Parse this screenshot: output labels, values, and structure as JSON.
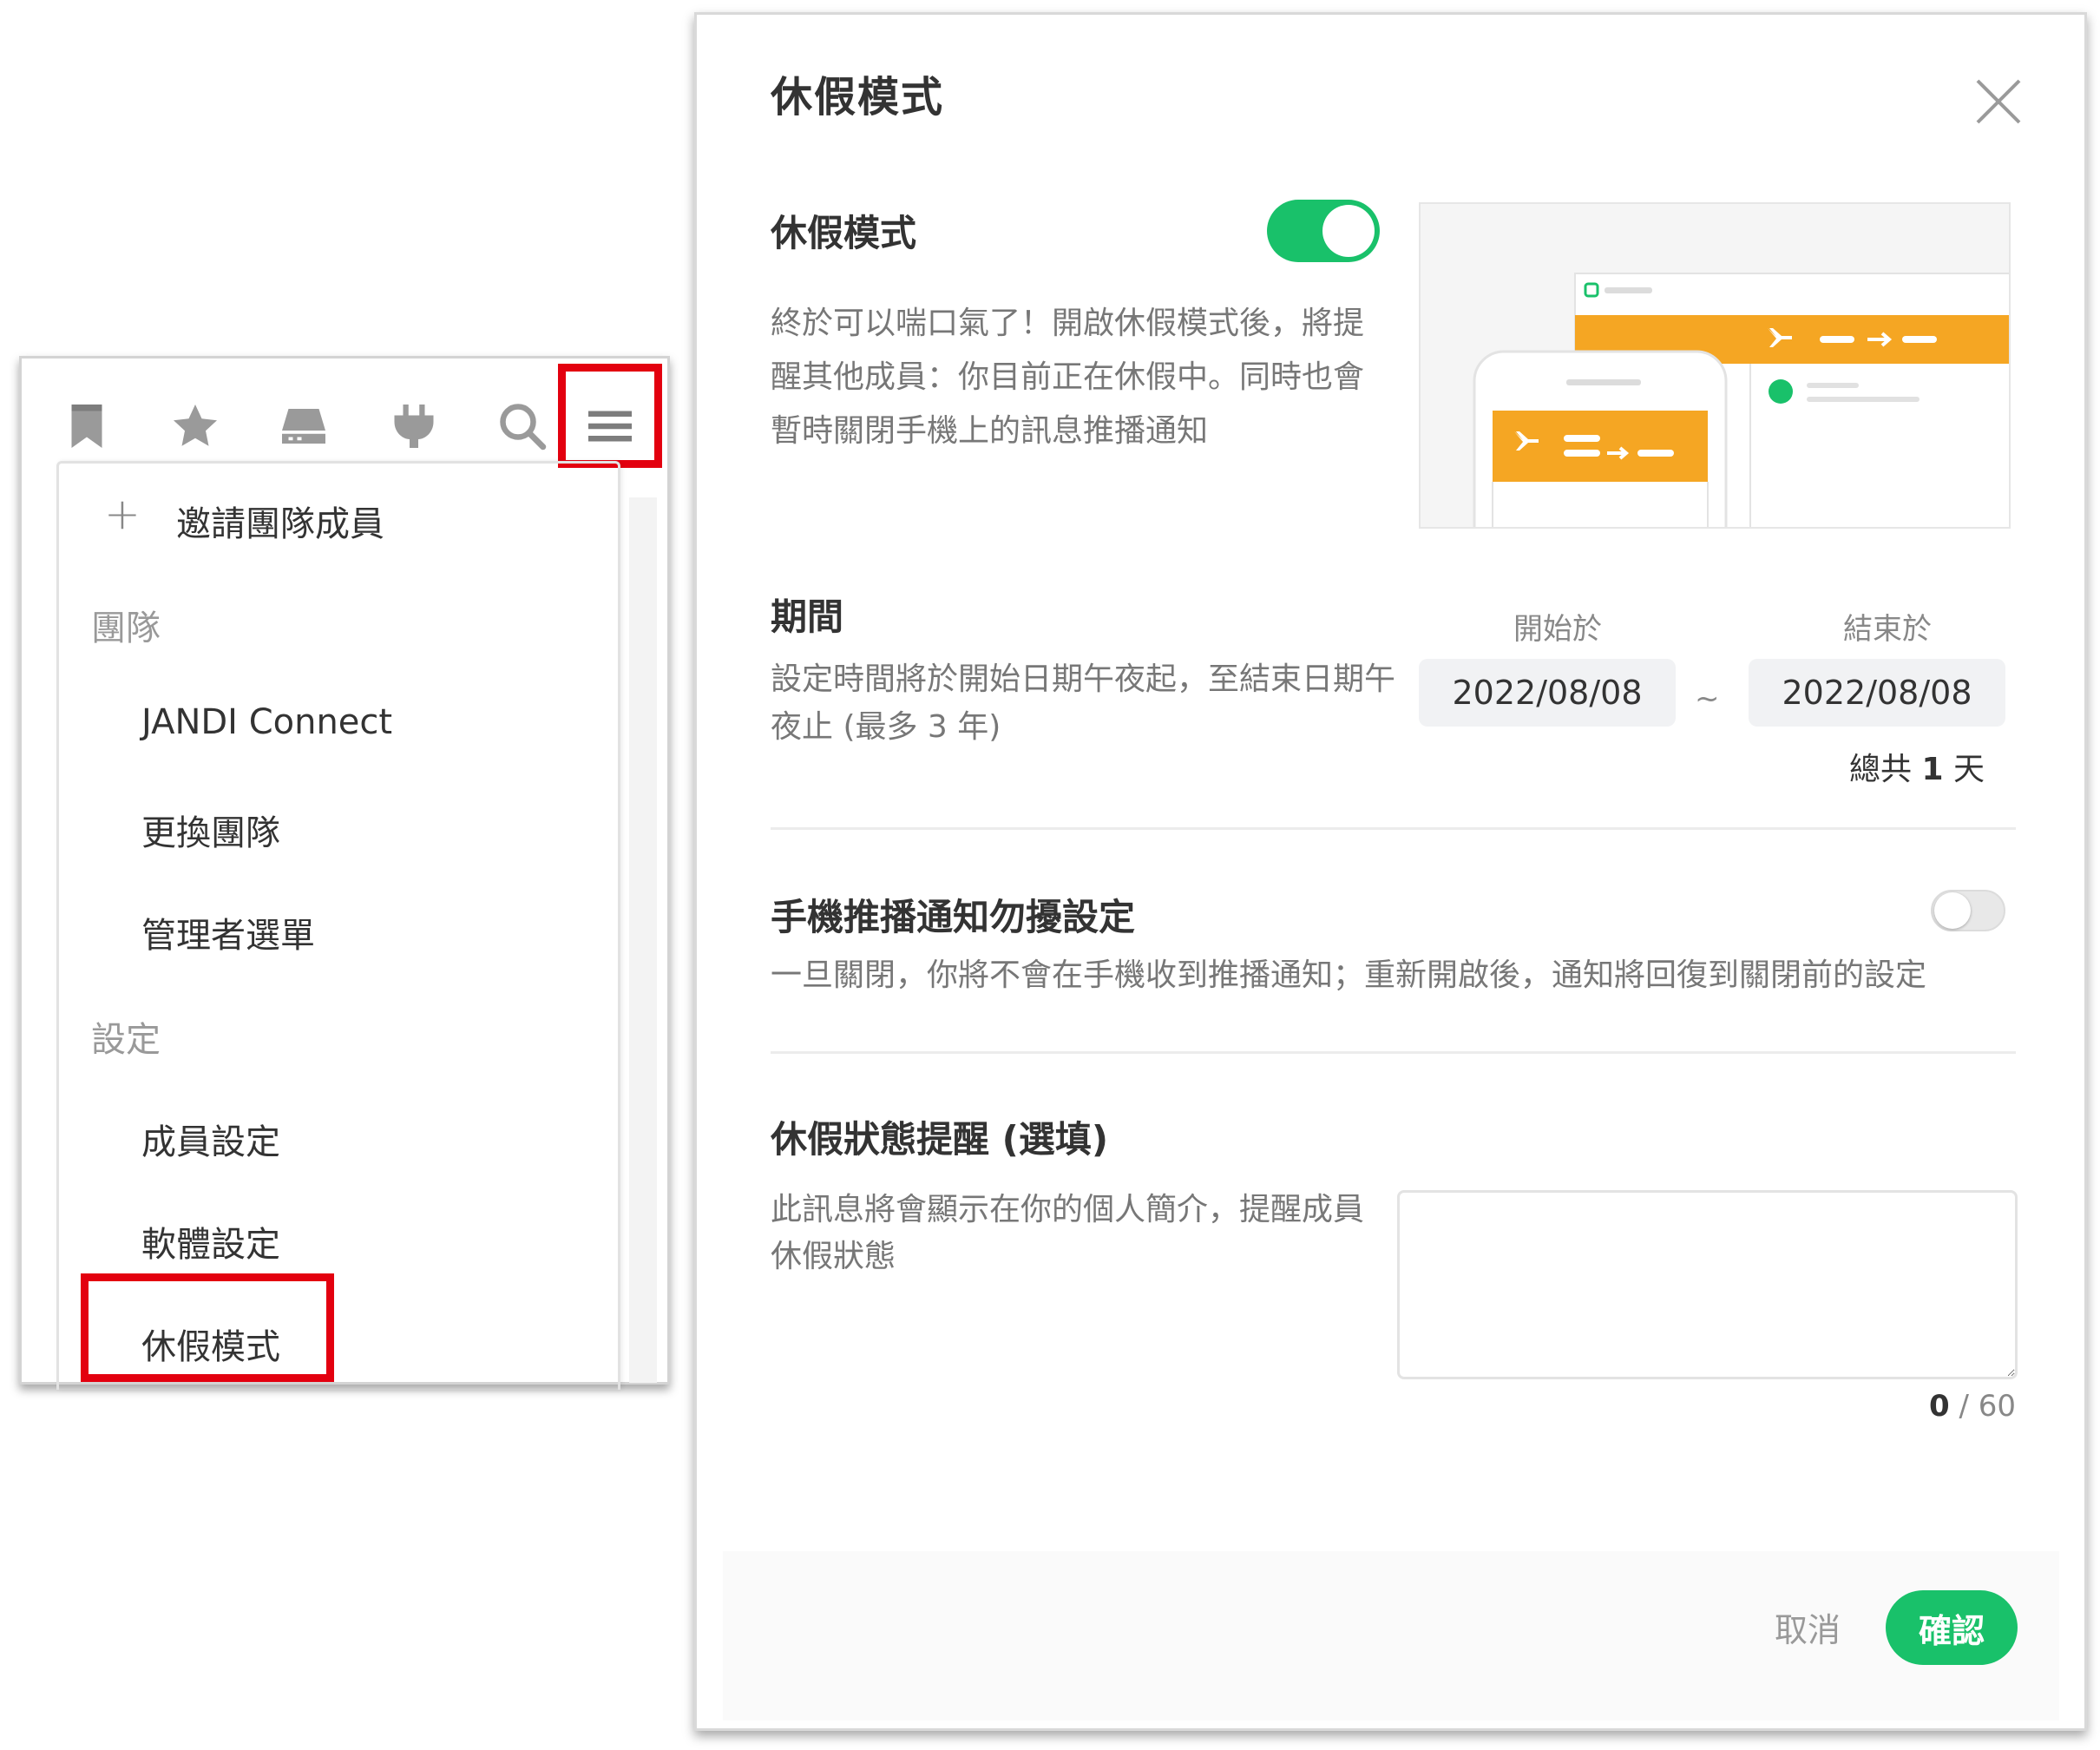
{
  "menu": {
    "toolbar_icons": [
      "bookmark-icon",
      "star-icon",
      "drive-icon",
      "plug-icon",
      "search-icon",
      "hamburger-menu-icon"
    ],
    "invite": "邀請團隊成員",
    "team_section": "團隊",
    "team_items": [
      "JANDI Connect",
      "更換團隊",
      "管理者選單"
    ],
    "settings_section": "設定",
    "settings_items": [
      "成員設定",
      "軟體設定",
      "休假模式"
    ]
  },
  "dialog": {
    "title": "休假模式",
    "vacation": {
      "title": "休假模式",
      "enabled": true,
      "description": "終於可以喘口氣了！開啟休假模式後，將提醒其他成員：你目前正在休假中。同時也會暫時關閉手機上的訊息推播通知"
    },
    "period": {
      "title": "期間",
      "description": "設定時間將於開始日期午夜起，至結束日期午夜止 (最多 3 年)",
      "start_label": "開始於",
      "end_label": "結束於",
      "start_date": "2022/08/08",
      "end_date": "2022/08/08",
      "separator": "~",
      "total_prefix": "總共",
      "total_days": "1",
      "total_suffix": "天"
    },
    "push": {
      "title": "手機推播通知勿擾設定",
      "enabled": false,
      "description": "一旦關閉，你將不會在手機收到推播通知；重新開啟後，通知將回復到關閉前的設定"
    },
    "status_message": {
      "title": "休假狀態提醒 (選填)",
      "description": "此訊息將會顯示在你的個人簡介，提醒成員休假狀態",
      "value": "",
      "count": "0",
      "max": "/ 60"
    },
    "cancel_label": "取消",
    "confirm_label": "確認"
  },
  "colors": {
    "accent": "#19c16a",
    "highlight": "#e3000f",
    "illustration_orange": "#f5a623"
  }
}
